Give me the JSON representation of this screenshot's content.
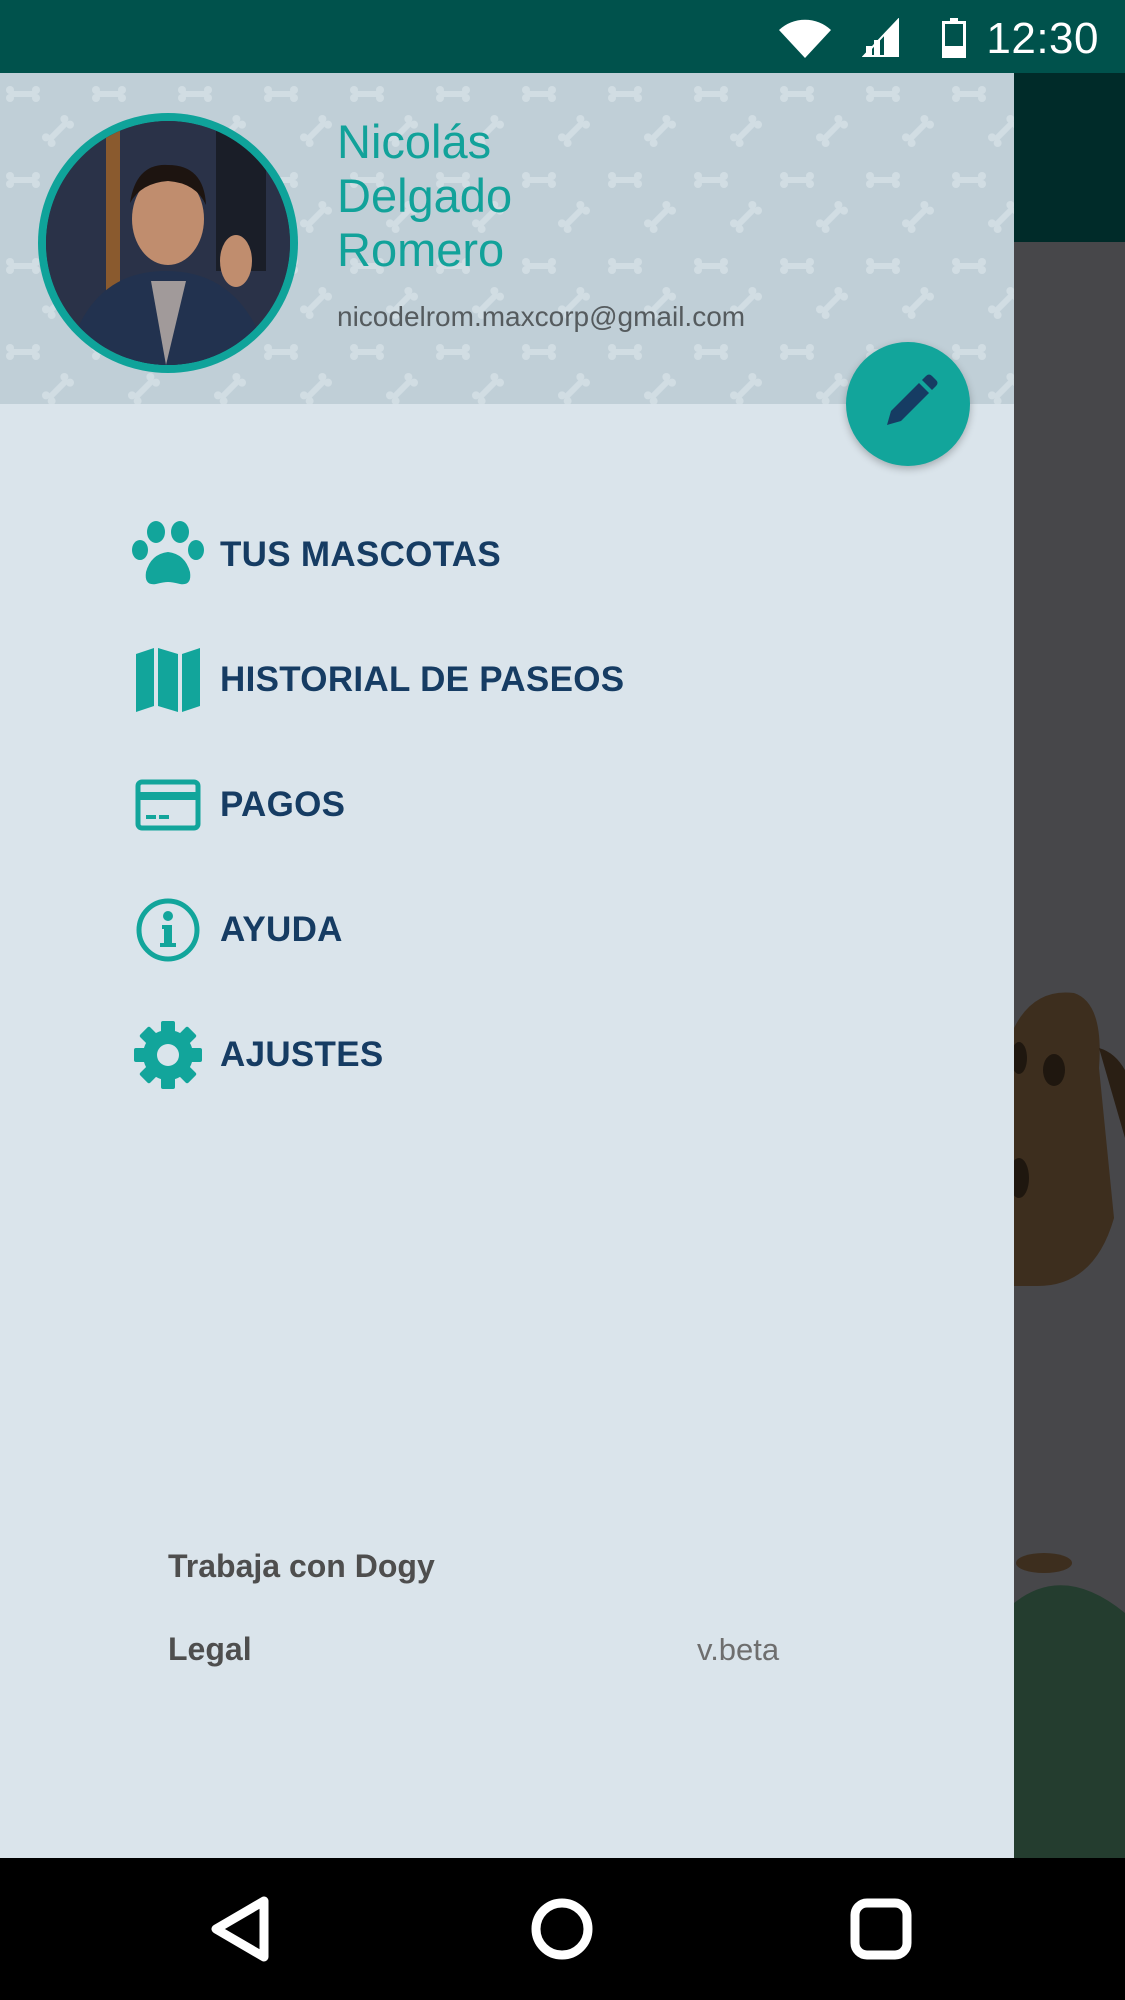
{
  "status_bar": {
    "time": "12:30",
    "icons": [
      "wifi-icon",
      "signal-icon",
      "battery-icon"
    ]
  },
  "drawer": {
    "user": {
      "name_lines": [
        "Nicolás",
        "Delgado",
        "Romero"
      ],
      "email": "nicodelrom.maxcorp@gmail.com"
    },
    "edit_fab_icon": "pencil-icon",
    "menu": [
      {
        "label": "TUS MASCOTAS",
        "icon": "paw-icon"
      },
      {
        "label": "HISTORIAL DE PASEOS",
        "icon": "map-icon"
      },
      {
        "label": "PAGOS",
        "icon": "credit-card-icon"
      },
      {
        "label": "AYUDA",
        "icon": "info-icon"
      },
      {
        "label": "AJUSTES",
        "icon": "gear-icon"
      }
    ],
    "footer": {
      "work_link": "Trabaja con Dogy",
      "legal_link": "Legal",
      "version": "v.beta"
    }
  },
  "nav_bar": {
    "buttons": [
      "back-icon",
      "home-icon",
      "recents-icon"
    ]
  },
  "colors": {
    "accent": "#12a59b",
    "primary_dark": "#00524c",
    "menu_text": "#163c63",
    "drawer_bg": "#dae4eb",
    "header_bg": "#c0cfd7"
  }
}
